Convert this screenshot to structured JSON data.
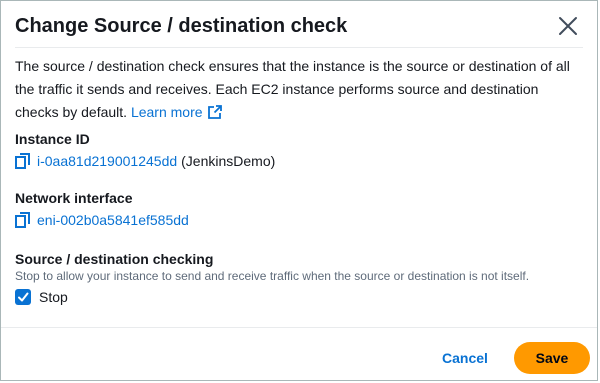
{
  "modal": {
    "title": "Change Source / destination check",
    "description": "The source / destination check ensures that the instance is the source or destination of all the traffic it sends and receives. Each EC2 instance performs source and destination checks by default.",
    "learn_more": "Learn more",
    "close_icon": "close-icon",
    "external_icon": "external-link-icon"
  },
  "instance": {
    "label": "Instance ID",
    "id": "i-0aa81d219001245dd",
    "name": "(JenkinsDemo)",
    "icon": "copy-icon"
  },
  "network": {
    "label": "Network interface",
    "id": "eni-002b0a5841ef585dd",
    "icon": "copy-icon"
  },
  "checking": {
    "label": "Source / destination checking",
    "hint": "Stop to allow your instance to send and receive traffic when the source or destination is not itself.",
    "checkbox_label": "Stop",
    "checked": true
  },
  "footer": {
    "cancel_label": "Cancel",
    "save_label": "Save"
  },
  "colors": {
    "link": "#0972d3",
    "primary": "#ff9900",
    "text": "#16191f"
  }
}
